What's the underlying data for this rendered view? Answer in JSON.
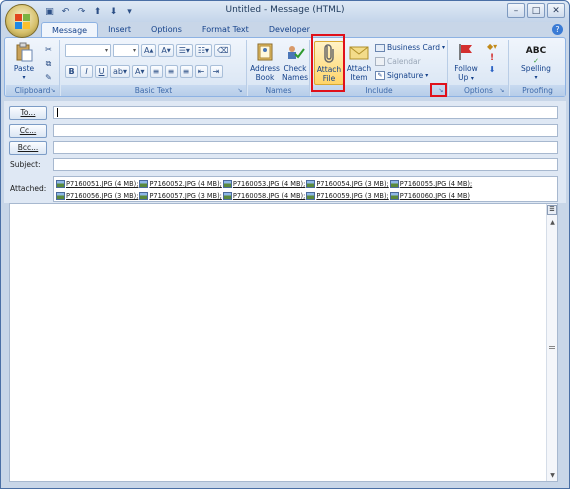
{
  "window": {
    "title": "Untitled - Message (HTML)"
  },
  "tabs": [
    {
      "label": "Message",
      "active": true
    },
    {
      "label": "Insert"
    },
    {
      "label": "Options"
    },
    {
      "label": "Format Text"
    },
    {
      "label": "Developer"
    }
  ],
  "ribbon": {
    "groups": {
      "clipboard": "Clipboard",
      "basic_text": "Basic Text",
      "names": "Names",
      "include": "Include",
      "options": "Options",
      "proofing": "Proofing"
    },
    "paste": "Paste",
    "address_book": [
      "Address",
      "Book"
    ],
    "check_names": [
      "Check",
      "Names"
    ],
    "attach_file": [
      "Attach",
      "File"
    ],
    "attach_item": [
      "Attach",
      "Item"
    ],
    "business_card": "Business Card",
    "calendar": "Calendar",
    "signature": "Signature",
    "follow_up": [
      "Follow",
      "Up"
    ],
    "spelling": "Spelling",
    "spelling_icon": "ABC"
  },
  "header": {
    "to": "To...",
    "cc": "Cc...",
    "bcc": "Bcc...",
    "subject": "Subject:",
    "attached": "Attached:"
  },
  "attachments": [
    "P7160051.JPG (4 MB);",
    "P7160052.JPG (4 MB);",
    "P7160053.JPG (4 MB);",
    "P7160054.JPG (3 MB);",
    "P7160055.JPG (4 MB);",
    "P7160056.JPG (3 MB);",
    "P7160057.JPG (3 MB);",
    "P7160058.JPG (4 MB);",
    "P7160059.JPG (3 MB);",
    "P7160060.JPG (4 MB)"
  ],
  "colors": {
    "highlight": "#e0101a",
    "tab_text": "#15428b"
  }
}
